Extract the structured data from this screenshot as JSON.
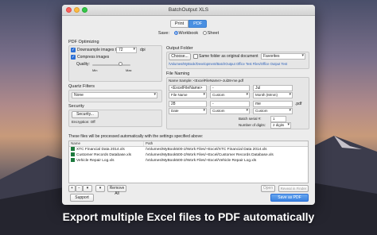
{
  "window": {
    "title": "BatchOutput XLS",
    "tabs": [
      {
        "label": "Print",
        "selected": false
      },
      {
        "label": "PDF",
        "selected": true
      }
    ],
    "save": {
      "label": "Save:",
      "options": [
        {
          "label": "Workbook",
          "selected": true
        },
        {
          "label": "Sheet",
          "selected": false
        }
      ]
    }
  },
  "pdf_optimizing": {
    "title": "PDF Optimizing",
    "downsample_label": "Downsample images to",
    "downsample_checked": true,
    "dpi_value": "72",
    "dpi_unit": "dpi",
    "compress_label": "Compress images",
    "compress_checked": true,
    "quality_label": "Quality:",
    "quality_min": "Min",
    "quality_max": "Max",
    "quality_level": 0.75
  },
  "quartz_filters": {
    "title": "Quartz Filters",
    "value": "None"
  },
  "security": {
    "title": "Security",
    "button": "Security...",
    "encryption": "Encryption: Off"
  },
  "output_folder": {
    "title": "Output Folder",
    "choose": "Choose...",
    "same_folder_label": "Same folder as original document",
    "same_folder_checked": false,
    "favorites": "Favorites",
    "path": "/Volumes/MyBook/Development/BatchOutput Office Test Files/Office Output Test"
  },
  "file_naming": {
    "title": "File Naming",
    "sample": "Name Sample: <ExcelFileName>-Jul28-me.pdf",
    "rows": [
      {
        "a": "<ExcelFileName>",
        "b": "-",
        "c": "Jul"
      },
      {
        "a": "File Name",
        "b": "Custom",
        "c": "Month (Mmm)"
      },
      {
        "a": "28",
        "b": "-",
        "c": "me"
      },
      {
        "a": "Date",
        "b": "Custom",
        "c": "Custom"
      }
    ],
    "ext": ".pdf",
    "batch_serial_label": "Batch serial #:",
    "batch_serial_value": "1",
    "digits_label": "Number of digits:",
    "digits_value": "2 digits"
  },
  "files": {
    "caption": "These files will be processed automatically with the settings specified above:",
    "headers": [
      "Name",
      "Path"
    ],
    "rows": [
      {
        "name": "XTC Financial Data 2014.xls",
        "path": "/Volumes/MyBook500-2/Work Files/+Excel/XTC Financial Data 2014.xls"
      },
      {
        "name": "Customer Records Database.xls",
        "path": "/Volumes/MyBook500-2/Work Files/+Excel/Customer Records Database.xls"
      },
      {
        "name": "Vehicle Repair Log.xls",
        "path": "/Volumes/MyBook500-2/Work Files/+Excel/Vehicle Repair Log.xls"
      }
    ],
    "remove_all": "Remove All",
    "open": "Open",
    "reveal": "Reveal in Finder"
  },
  "footer": {
    "support": "Support",
    "save_pdf": "Save as PDF"
  },
  "caption": "Export multiple Excel files to PDF automatically"
}
